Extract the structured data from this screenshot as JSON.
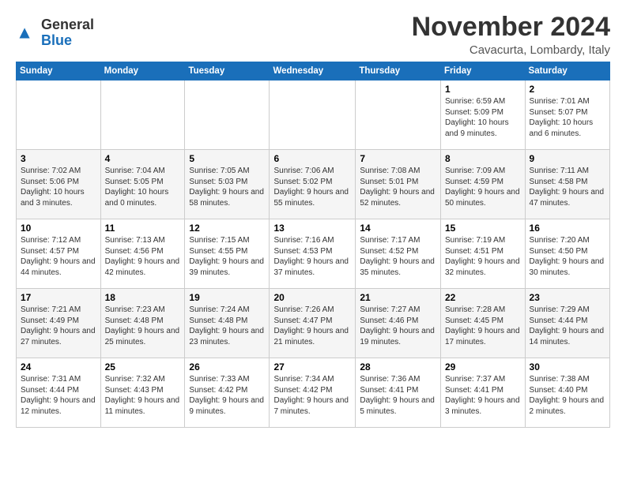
{
  "header": {
    "logo_general": "General",
    "logo_blue": "Blue",
    "month_title": "November 2024",
    "subtitle": "Cavacurta, Lombardy, Italy"
  },
  "days_of_week": [
    "Sunday",
    "Monday",
    "Tuesday",
    "Wednesday",
    "Thursday",
    "Friday",
    "Saturday"
  ],
  "weeks": [
    [
      {
        "day": "",
        "info": ""
      },
      {
        "day": "",
        "info": ""
      },
      {
        "day": "",
        "info": ""
      },
      {
        "day": "",
        "info": ""
      },
      {
        "day": "",
        "info": ""
      },
      {
        "day": "1",
        "info": "Sunrise: 6:59 AM\nSunset: 5:09 PM\nDaylight: 10 hours and 9 minutes."
      },
      {
        "day": "2",
        "info": "Sunrise: 7:01 AM\nSunset: 5:07 PM\nDaylight: 10 hours and 6 minutes."
      }
    ],
    [
      {
        "day": "3",
        "info": "Sunrise: 7:02 AM\nSunset: 5:06 PM\nDaylight: 10 hours and 3 minutes."
      },
      {
        "day": "4",
        "info": "Sunrise: 7:04 AM\nSunset: 5:05 PM\nDaylight: 10 hours and 0 minutes."
      },
      {
        "day": "5",
        "info": "Sunrise: 7:05 AM\nSunset: 5:03 PM\nDaylight: 9 hours and 58 minutes."
      },
      {
        "day": "6",
        "info": "Sunrise: 7:06 AM\nSunset: 5:02 PM\nDaylight: 9 hours and 55 minutes."
      },
      {
        "day": "7",
        "info": "Sunrise: 7:08 AM\nSunset: 5:01 PM\nDaylight: 9 hours and 52 minutes."
      },
      {
        "day": "8",
        "info": "Sunrise: 7:09 AM\nSunset: 4:59 PM\nDaylight: 9 hours and 50 minutes."
      },
      {
        "day": "9",
        "info": "Sunrise: 7:11 AM\nSunset: 4:58 PM\nDaylight: 9 hours and 47 minutes."
      }
    ],
    [
      {
        "day": "10",
        "info": "Sunrise: 7:12 AM\nSunset: 4:57 PM\nDaylight: 9 hours and 44 minutes."
      },
      {
        "day": "11",
        "info": "Sunrise: 7:13 AM\nSunset: 4:56 PM\nDaylight: 9 hours and 42 minutes."
      },
      {
        "day": "12",
        "info": "Sunrise: 7:15 AM\nSunset: 4:55 PM\nDaylight: 9 hours and 39 minutes."
      },
      {
        "day": "13",
        "info": "Sunrise: 7:16 AM\nSunset: 4:53 PM\nDaylight: 9 hours and 37 minutes."
      },
      {
        "day": "14",
        "info": "Sunrise: 7:17 AM\nSunset: 4:52 PM\nDaylight: 9 hours and 35 minutes."
      },
      {
        "day": "15",
        "info": "Sunrise: 7:19 AM\nSunset: 4:51 PM\nDaylight: 9 hours and 32 minutes."
      },
      {
        "day": "16",
        "info": "Sunrise: 7:20 AM\nSunset: 4:50 PM\nDaylight: 9 hours and 30 minutes."
      }
    ],
    [
      {
        "day": "17",
        "info": "Sunrise: 7:21 AM\nSunset: 4:49 PM\nDaylight: 9 hours and 27 minutes."
      },
      {
        "day": "18",
        "info": "Sunrise: 7:23 AM\nSunset: 4:48 PM\nDaylight: 9 hours and 25 minutes."
      },
      {
        "day": "19",
        "info": "Sunrise: 7:24 AM\nSunset: 4:48 PM\nDaylight: 9 hours and 23 minutes."
      },
      {
        "day": "20",
        "info": "Sunrise: 7:26 AM\nSunset: 4:47 PM\nDaylight: 9 hours and 21 minutes."
      },
      {
        "day": "21",
        "info": "Sunrise: 7:27 AM\nSunset: 4:46 PM\nDaylight: 9 hours and 19 minutes."
      },
      {
        "day": "22",
        "info": "Sunrise: 7:28 AM\nSunset: 4:45 PM\nDaylight: 9 hours and 17 minutes."
      },
      {
        "day": "23",
        "info": "Sunrise: 7:29 AM\nSunset: 4:44 PM\nDaylight: 9 hours and 14 minutes."
      }
    ],
    [
      {
        "day": "24",
        "info": "Sunrise: 7:31 AM\nSunset: 4:44 PM\nDaylight: 9 hours and 12 minutes."
      },
      {
        "day": "25",
        "info": "Sunrise: 7:32 AM\nSunset: 4:43 PM\nDaylight: 9 hours and 11 minutes."
      },
      {
        "day": "26",
        "info": "Sunrise: 7:33 AM\nSunset: 4:42 PM\nDaylight: 9 hours and 9 minutes."
      },
      {
        "day": "27",
        "info": "Sunrise: 7:34 AM\nSunset: 4:42 PM\nDaylight: 9 hours and 7 minutes."
      },
      {
        "day": "28",
        "info": "Sunrise: 7:36 AM\nSunset: 4:41 PM\nDaylight: 9 hours and 5 minutes."
      },
      {
        "day": "29",
        "info": "Sunrise: 7:37 AM\nSunset: 4:41 PM\nDaylight: 9 hours and 3 minutes."
      },
      {
        "day": "30",
        "info": "Sunrise: 7:38 AM\nSunset: 4:40 PM\nDaylight: 9 hours and 2 minutes."
      }
    ]
  ]
}
